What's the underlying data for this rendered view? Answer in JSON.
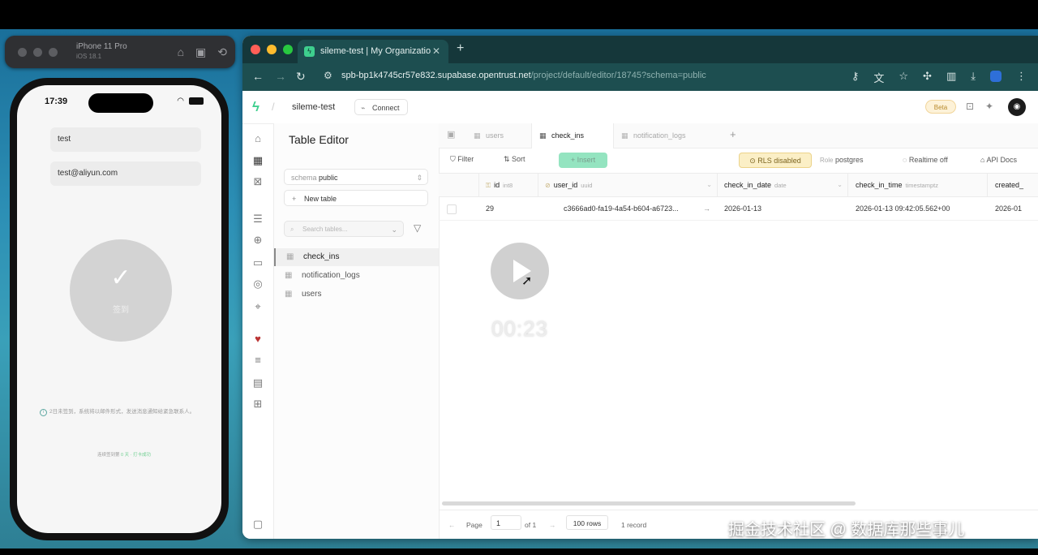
{
  "simulator": {
    "device_name": "iPhone 11 Pro",
    "device_os": "iOS 18.1"
  },
  "phone": {
    "time": "17:39",
    "name_field": "test",
    "email_field": "test@aliyun.com",
    "checkin_label": "签到",
    "info_text": "2日未签到，系统将以邮件形式，发送消息通知给紧急联系人。",
    "footer_prefix": "连续签到第",
    "footer_highlight": "0 天 · 打卡成功"
  },
  "browser": {
    "tab_title": "sileme-test | My Organizatio",
    "url_host": "spb-bp1k4745cr57e832.supabase.opentrust.net",
    "url_path": "/project/default/editor/18745?schema=public"
  },
  "app": {
    "project_name": "sileme-test",
    "connect_label": "Connect",
    "beta_label": "Beta",
    "panel_title": "Table Editor",
    "schema_label": "schema",
    "schema_value": "public",
    "new_table_label": "New table",
    "search_placeholder": "Search tables...",
    "tables": [
      "check_ins",
      "notification_logs",
      "users"
    ],
    "tabs": [
      {
        "label": "users"
      },
      {
        "label": "check_ins"
      },
      {
        "label": "notification_logs"
      }
    ],
    "toolbar": {
      "filter": "Filter",
      "sort": "Sort",
      "insert": "Insert",
      "rls": "RLS disabled",
      "role_label": "Role",
      "role_value": "postgres",
      "realtime": "Realtime off",
      "api_docs": "API Docs"
    },
    "columns": [
      {
        "name": "id",
        "type": "int8"
      },
      {
        "name": "user_id",
        "type": "uuid"
      },
      {
        "name": "check_in_date",
        "type": "date"
      },
      {
        "name": "check_in_time",
        "type": "timestamptz"
      },
      {
        "name": "created_",
        "type": ""
      }
    ],
    "row": {
      "id": "29",
      "user_id": "c3666ad0-fa19-4a54-b604-a6723...",
      "check_in_date": "2026-01-13",
      "check_in_time": "2026-01-13 09:42:05.562+00",
      "created": "2026-01"
    },
    "footer": {
      "page_label": "Page",
      "page_value": "1",
      "of_label": "of 1",
      "rows_label": "100 rows",
      "records_label": "1 record"
    }
  },
  "overlay": {
    "video_time": "00:23",
    "watermark": "掘金技术社区 @ 数据库那些事儿"
  },
  "colors": {
    "brand": "#3ecf8e",
    "browser_chrome": "#1d4e50",
    "rls_warning": "#fbefc6"
  }
}
